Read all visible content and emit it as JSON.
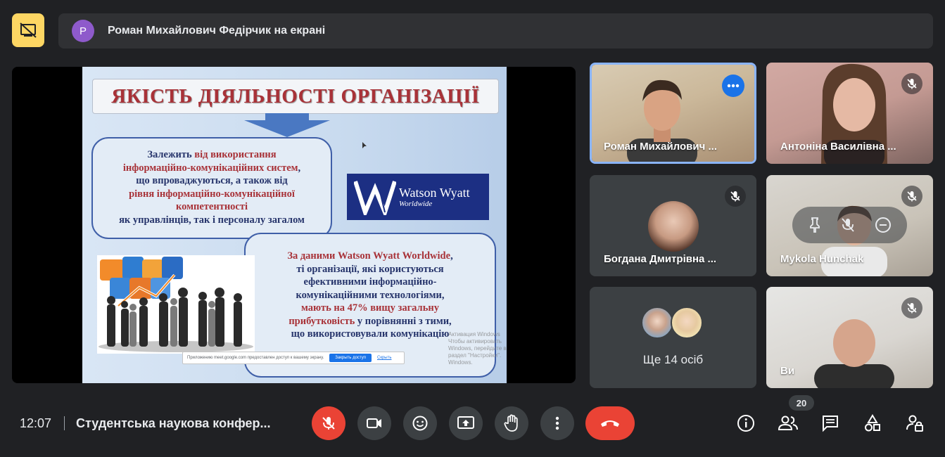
{
  "top": {
    "presenter_initial": "Р",
    "presenter_text": "Роман Михайлович Федірчик на екрані"
  },
  "slide": {
    "title": "ЯКІСТЬ ДІЯЛЬНОСТІ ОРГАНІЗАЦІЇ",
    "bubble1": [
      {
        "text": "Залежить ",
        "hl": false
      },
      {
        "text": "від використання",
        "hl": true
      },
      {
        "text": "інформаційно-комунікаційних систем",
        "hl": true,
        "br": true
      },
      {
        "text": ",",
        "hl": false
      },
      {
        "text": "що впроваджуються, а також від",
        "hl": false,
        "br": true
      },
      {
        "text": "рівня інформаційно-комунікаційної",
        "hl": true,
        "br": true
      },
      {
        "text": "компетентності",
        "hl": true,
        "br": true
      },
      {
        "text": "як управлінців, так і персоналу загалом",
        "hl": false,
        "br": true
      }
    ],
    "bubble2": [
      {
        "text": "За даними Watson Wyatt Worldwide",
        "hl": true
      },
      {
        "text": ",",
        "hl": false
      },
      {
        "text": "ті організації, які користуються",
        "hl": false,
        "br": true
      },
      {
        "text": "ефективними інформаційно-",
        "hl": false,
        "br": true
      },
      {
        "text": "комунікаційними технологіями,",
        "hl": false,
        "br": true
      },
      {
        "text": "мають на 47% вищу загальну",
        "hl": true,
        "br": true
      },
      {
        "text": "прибутковість",
        "hl": true,
        "br": true
      },
      {
        "text": " у порівнянні з тими,",
        "hl": false
      },
      {
        "text": "що використовували комунікацію",
        "hl": false,
        "br": true
      }
    ],
    "logo_name": "Watson Wyatt",
    "logo_sub": "Worldwide",
    "share_notice": "Приложению meet.google.com предоставлен доступ к вашему экрану.",
    "share_stop": "Закрыть доступ",
    "share_hide": "Скрыть",
    "watermark_1": "Активация Windows",
    "watermark_2": "Чтобы активировать Windows, перейдите в раздел \"Настройки\".",
    "watermark_3": "Windows."
  },
  "tiles": {
    "t1_name": "Роман Михайлович ...",
    "t2_name": "Антоніна Василівна ...",
    "t3_name": "Богдана Дмитрівна ...",
    "t4_name": "Mykola Hunchak",
    "t5_label": "Ще 14 осіб",
    "t6_name": "Ви"
  },
  "bottom": {
    "time": "12:07",
    "meeting_title": "Студентська наукова конфер...",
    "participants_count": "20"
  },
  "colors": {
    "accent": "#1a73e8",
    "danger": "#ea4335",
    "present_toggle": "#fdd663"
  }
}
